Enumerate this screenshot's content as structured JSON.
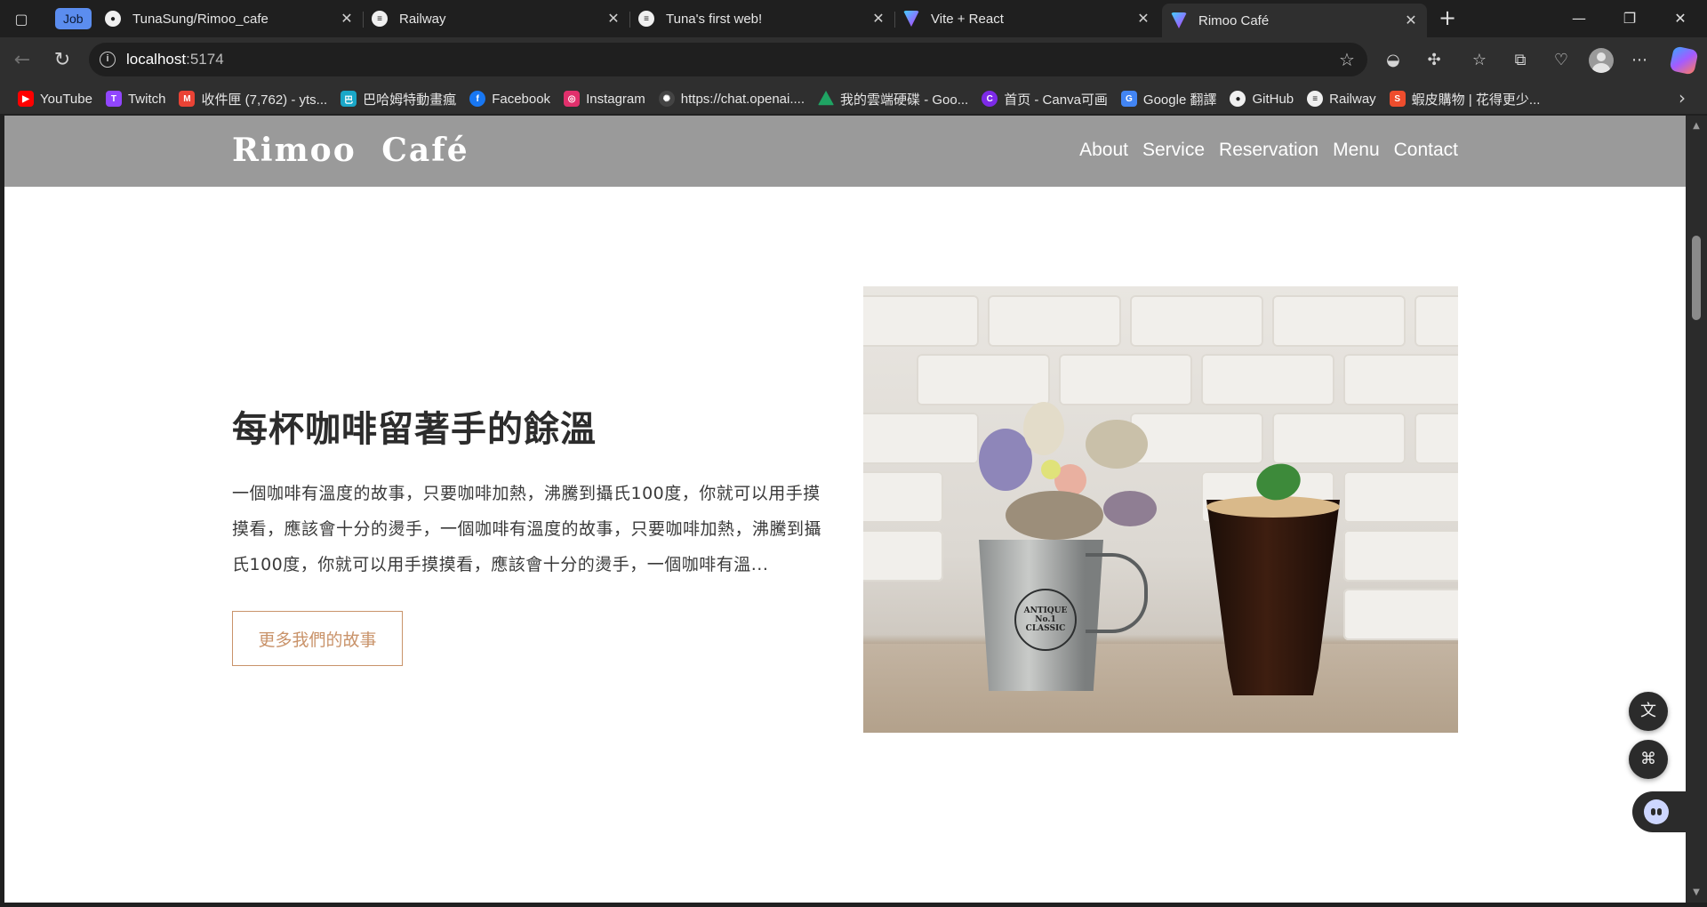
{
  "browser": {
    "workspace_badge": "Job",
    "tabs": [
      {
        "title": "TunaSung/Rimoo_cafe",
        "icon": "github-icon"
      },
      {
        "title": "Railway",
        "icon": "railway-icon"
      },
      {
        "title": "Tuna's first web!",
        "icon": "railway-icon"
      },
      {
        "title": "Vite + React",
        "icon": "vite-icon"
      },
      {
        "title": "Rimoo Café",
        "icon": "vite-icon",
        "active": true
      }
    ],
    "url_host": "localhost",
    "url_port": ":5174",
    "bookmarks": [
      {
        "label": "YouTube",
        "icon": "youtube-icon",
        "color": "#ff0000"
      },
      {
        "label": "Twitch",
        "icon": "twitch-icon",
        "color": "#9146ff"
      },
      {
        "label": "收件匣 (7,762) - yts...",
        "icon": "gmail-icon",
        "color": "#ea4335"
      },
      {
        "label": "巴哈姆特動畫瘋",
        "icon": "bahamut-icon",
        "color": "#1aa7c8"
      },
      {
        "label": "Facebook",
        "icon": "facebook-icon",
        "color": "#1877f2"
      },
      {
        "label": "Instagram",
        "icon": "instagram-icon",
        "color": "#e1306c"
      },
      {
        "label": "https://chat.openai....",
        "icon": "openai-icon",
        "color": "#444444"
      },
      {
        "label": "我的雲端硬碟 - Goo...",
        "icon": "google-drive-icon",
        "color": "#1fa463"
      },
      {
        "label": "首页 - Canva可画",
        "icon": "canva-icon",
        "color": "#7d2ae8"
      },
      {
        "label": "Google 翻譯",
        "icon": "google-translate-icon",
        "color": "#4285f4"
      },
      {
        "label": "GitHub",
        "icon": "github-icon",
        "color": "#f0f0f0"
      },
      {
        "label": "Railway",
        "icon": "railway-icon",
        "color": "#f0f0f0"
      },
      {
        "label": "蝦皮購物 | 花得更少...",
        "icon": "shopee-icon",
        "color": "#ee4d2d"
      }
    ]
  },
  "site": {
    "logo": "Rimoo Café",
    "nav": [
      "About",
      "Service",
      "Reservation",
      "Menu",
      "Contact"
    ],
    "hero_title": "每杯咖啡留著手的餘溫",
    "hero_text": "一個咖啡有溫度的故事，只要咖啡加熱，沸騰到攝氏100度，你就可以用手摸摸看，應該會十分的燙手，一個咖啡有溫度的故事，只要咖啡加熱，沸騰到攝氏100度，你就可以用手摸摸看，應該會十分的燙手，一個咖啡有溫...",
    "story_button": "更多我們的故事",
    "photo_label": "ANTIQUE No.1 CLASSIC",
    "accent_color": "#c9936a"
  }
}
